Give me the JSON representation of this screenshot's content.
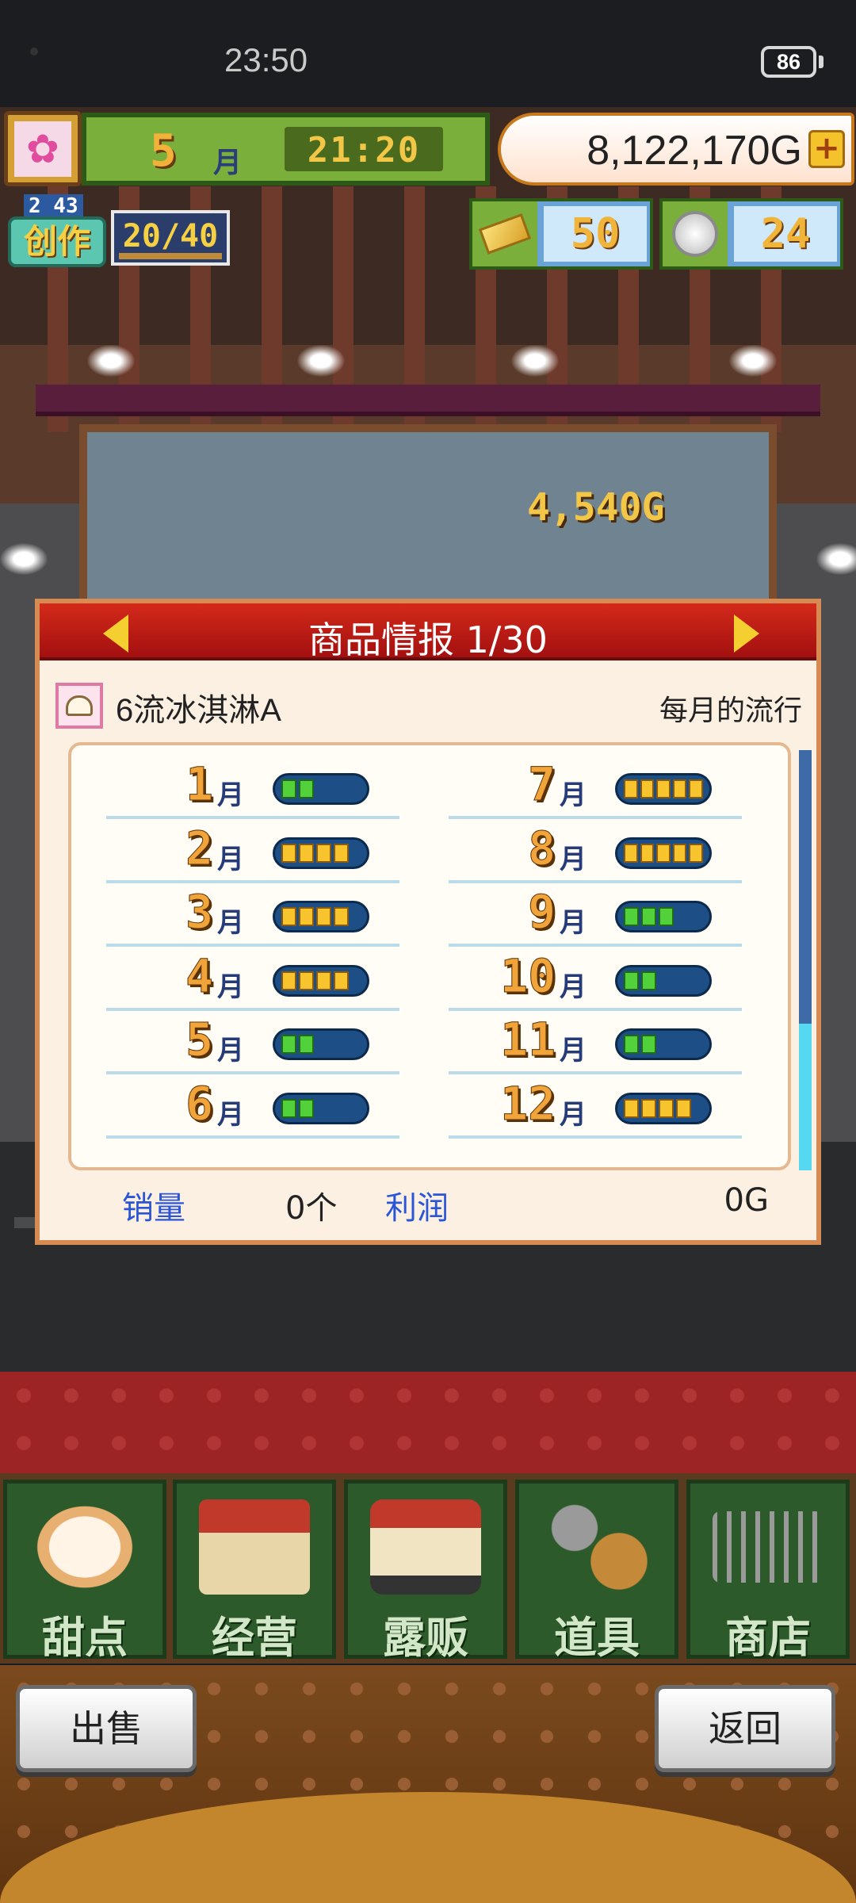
{
  "status_bar": {
    "time": "23:50",
    "battery": "86"
  },
  "hud": {
    "month": "5",
    "month_label": "月",
    "time": "21:20",
    "money": "8,122,170G",
    "money_plus": "+",
    "create_level": "2 43",
    "create_label": "创作",
    "create_count": "20/40",
    "gold_bars": "50",
    "medals": "24"
  },
  "scene": {
    "floating_sale": "4,540G"
  },
  "panel": {
    "title": "商品情报 1/30",
    "product_name": "6流冰淇淋A",
    "trend_label": "每月的流行",
    "months": [
      {
        "num": "1",
        "label": "月",
        "level": 2,
        "of": 5,
        "color": "green"
      },
      {
        "num": "2",
        "label": "月",
        "level": 4,
        "of": 5,
        "color": "yellow"
      },
      {
        "num": "3",
        "label": "月",
        "level": 4,
        "of": 5,
        "color": "yellow"
      },
      {
        "num": "4",
        "label": "月",
        "level": 4,
        "of": 5,
        "color": "yellow"
      },
      {
        "num": "5",
        "label": "月",
        "level": 2,
        "of": 5,
        "color": "green"
      },
      {
        "num": "6",
        "label": "月",
        "level": 2,
        "of": 5,
        "color": "green"
      },
      {
        "num": "7",
        "label": "月",
        "level": 5,
        "of": 5,
        "color": "yellow"
      },
      {
        "num": "8",
        "label": "月",
        "level": 5,
        "of": 5,
        "color": "yellow"
      },
      {
        "num": "9",
        "label": "月",
        "level": 3,
        "of": 5,
        "color": "green"
      },
      {
        "num": "10",
        "label": "月",
        "level": 2,
        "of": 5,
        "color": "green"
      },
      {
        "num": "11",
        "label": "月",
        "level": 2,
        "of": 5,
        "color": "green"
      },
      {
        "num": "12",
        "label": "月",
        "level": 4,
        "of": 5,
        "color": "yellow"
      }
    ],
    "sales_label": "销量",
    "sales_value": "0个",
    "profit_label": "利润",
    "profit_value": "0G"
  },
  "menu": [
    {
      "label": "甜点",
      "icon": "cake-icon"
    },
    {
      "label": "经营",
      "icon": "shop-icon"
    },
    {
      "label": "露贩",
      "icon": "food-truck-icon"
    },
    {
      "label": "道具",
      "icon": "items-icon"
    },
    {
      "label": "商店",
      "icon": "cart-icon"
    }
  ],
  "buttons": {
    "sell": "出售",
    "back": "返回"
  },
  "colors": {
    "header_red": "#c41e12",
    "month_number": "#f0a43a",
    "link_blue": "#2a55d8"
  }
}
